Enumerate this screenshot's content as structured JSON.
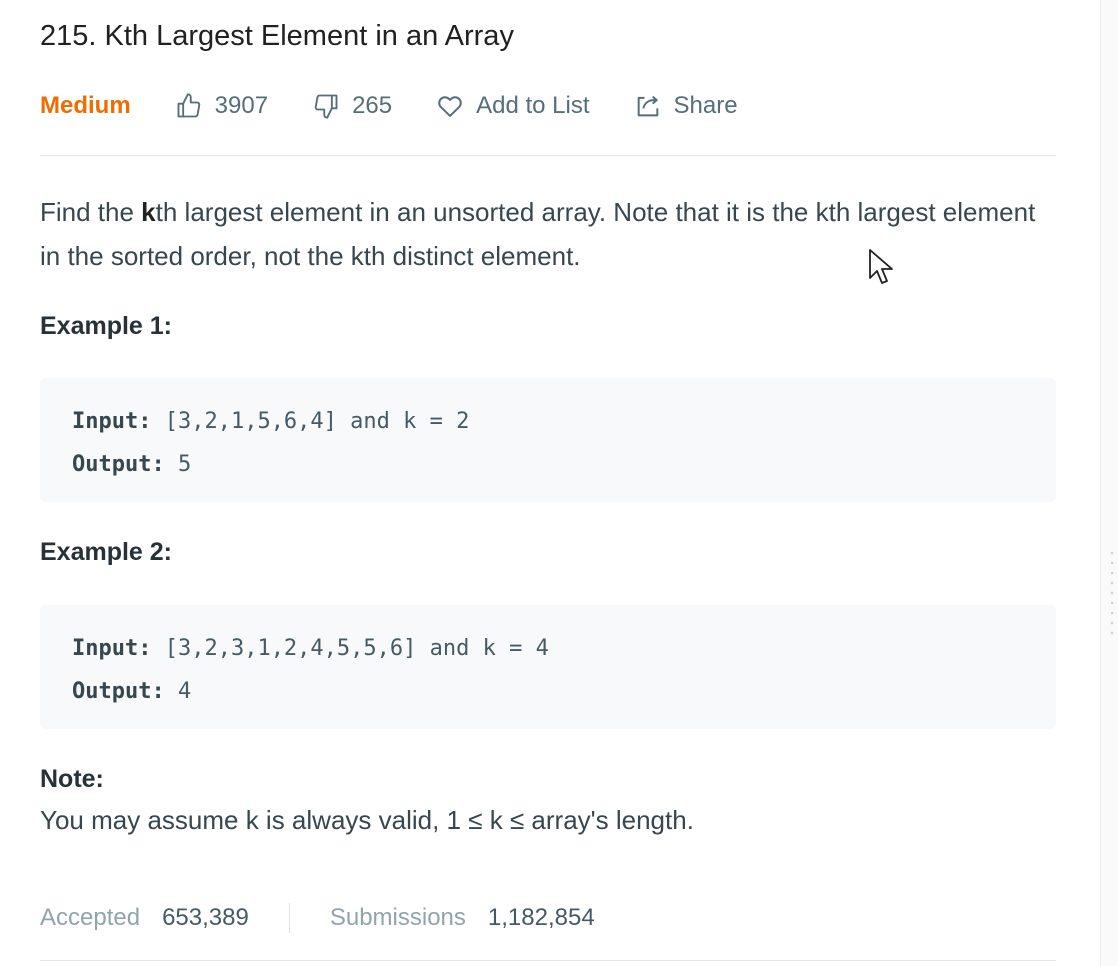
{
  "problem": {
    "number_title": "215. Kth Largest Element in an Array",
    "difficulty": "Medium",
    "likes": "3907",
    "dislikes": "265",
    "add_to_list": "Add to List",
    "share": "Share"
  },
  "description": {
    "part1": "Find the ",
    "bold": "k",
    "part2": "th largest element in an unsorted array. Note that it is the kth largest element in the sorted order, not the kth distinct element."
  },
  "examples": [
    {
      "title": "Example 1:",
      "input_label": "Input:",
      "input_value": " [3,2,1,5,6,4] and k = 2",
      "output_label": "Output:",
      "output_value": " 5"
    },
    {
      "title": "Example 2:",
      "input_label": "Input:",
      "input_value": " [3,2,3,1,2,4,5,5,6] and k = 4",
      "output_label": "Output:",
      "output_value": " 4"
    }
  ],
  "note": {
    "title": "Note:",
    "text": "You may assume k is always valid, 1 ≤ k ≤ array's length."
  },
  "stats": {
    "accepted_label": "Accepted",
    "accepted_value": "653,389",
    "submissions_label": "Submissions",
    "submissions_value": "1,182,854"
  },
  "colors": {
    "difficulty_medium": "#ef6c00",
    "code_background": "#f7f9fa"
  },
  "icons": {
    "like": "thumbs-up-icon",
    "dislike": "thumbs-down-icon",
    "add_to_list": "heart-icon",
    "share": "share-icon"
  }
}
